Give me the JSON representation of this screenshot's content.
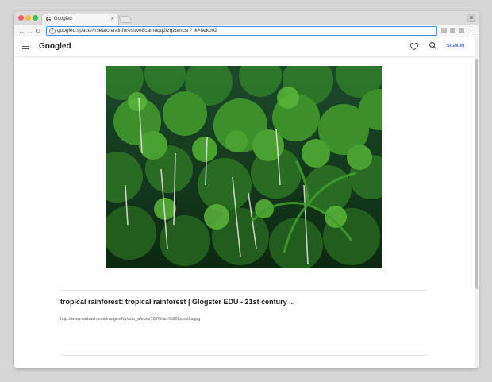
{
  "browser": {
    "tab_title": "Googled",
    "tab_favicon": "G",
    "url": "googled.space/#/search/rainforest/ve8camdqq2izgzumcsr?_k=8eko02"
  },
  "appbar": {
    "brand": "Googled",
    "signin_label": "SIGN IN",
    "icons": [
      "menu-icon",
      "heart-icon",
      "search-icon"
    ]
  },
  "result": {
    "title": "tropical rainforest: tropical rainforest | Glogster EDU - 21st century ...",
    "image_url": "http://www.wabash.edu/images2/photo_album/1576/rain%20forest1a.jpg"
  },
  "colors": {
    "accent": "#3d5afe",
    "omnibox_border": "#4a90d9"
  }
}
